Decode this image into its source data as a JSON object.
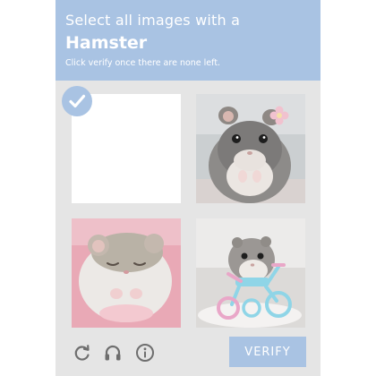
{
  "header": {
    "line1": "Select all images with a",
    "target": "Hamster",
    "instruction": "Click verify once there are none left."
  },
  "tiles": [
    {
      "content": "blank",
      "selected": true
    },
    {
      "content": "hamster-with-flower",
      "selected": false
    },
    {
      "content": "sleeping-hamster",
      "selected": false
    },
    {
      "content": "hamster-on-toy-tricycle",
      "selected": false
    }
  ],
  "footer": {
    "icons": [
      "reload-icon",
      "headphones-icon",
      "info-icon"
    ],
    "verify_label": "VERIFY"
  },
  "colors": {
    "accent": "#a9c3e3",
    "panel": "#e5e5e5",
    "text_on_accent": "#ffffff"
  }
}
